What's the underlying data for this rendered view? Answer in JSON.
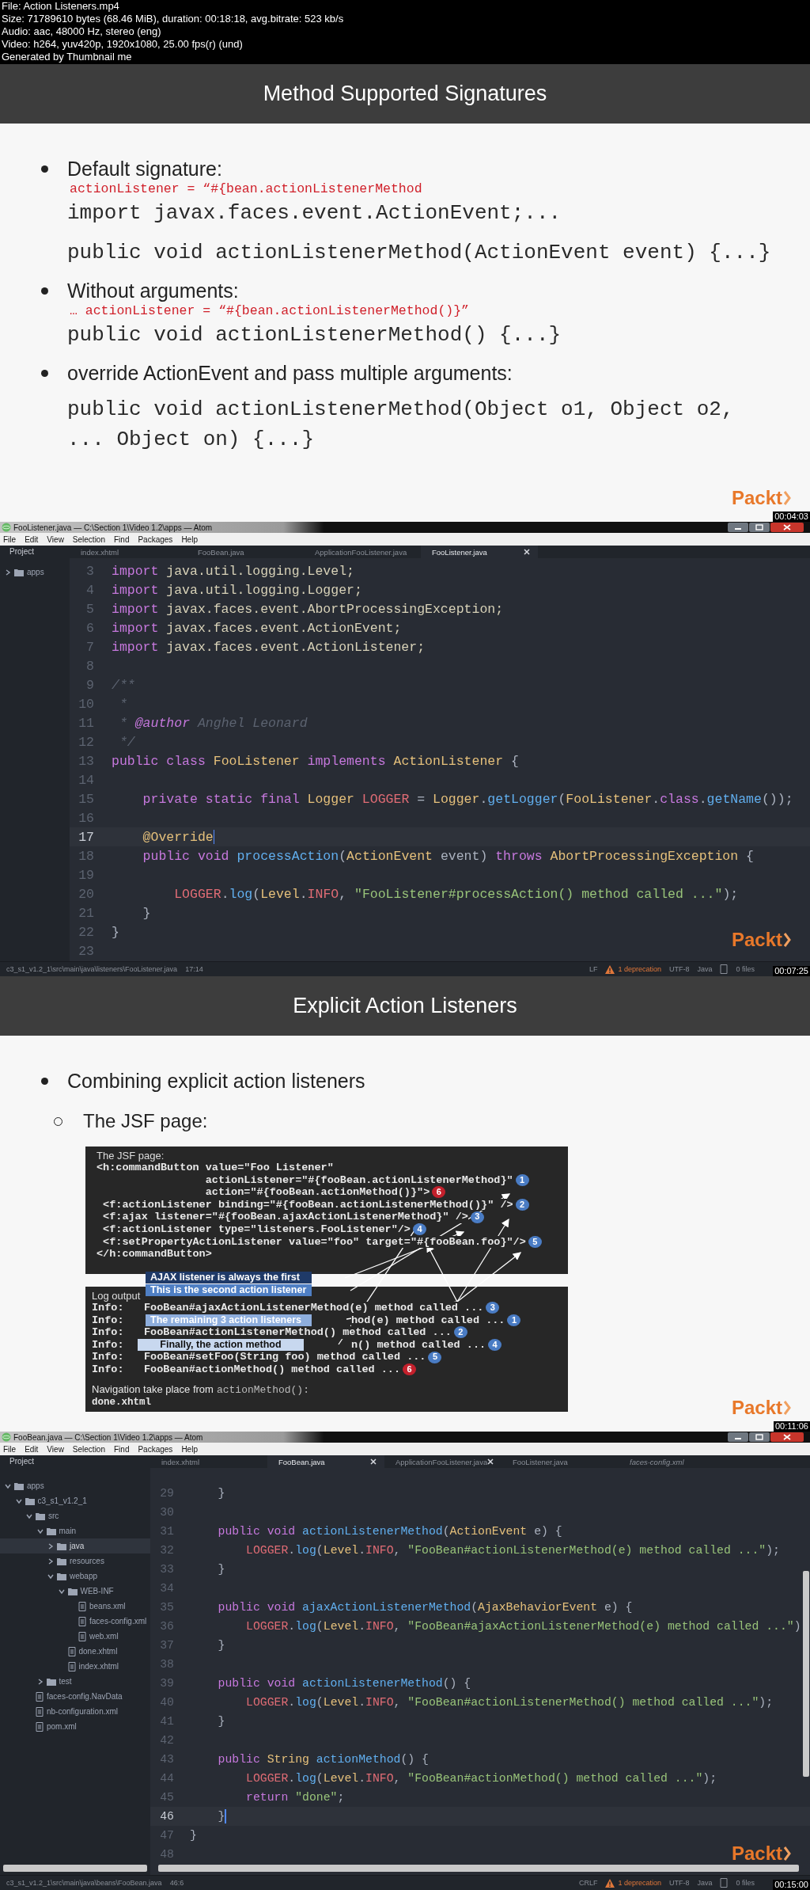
{
  "info_header": {
    "lines": [
      "File: Action Listeners.mp4",
      "Size: 71789610 bytes (68.46 MiB), duration: 00:18:18, avg.bitrate: 523 kb/s",
      "Audio: aac, 48000 Hz, stereo (eng)",
      "Video: h264, yuv420p, 1920x1080, 25.00 fps(r) (und)",
      "Generated by Thumbnail me"
    ]
  },
  "frames": [
    {
      "kind": "slide",
      "title": "Method Supported Signatures",
      "logo": "Packt",
      "timestamp": "00:04:03",
      "bullets": [
        {
          "text": "Default signature:",
          "details": [
            {
              "kind": "attribute",
              "text": "actionListener = “#{bean.actionListenerMethod"
            },
            {
              "kind": "code",
              "text": "import javax.faces.event.ActionEvent;..."
            },
            {
              "kind": "code",
              "text": "public void actionListenerMethod(ActionEvent event) {...}"
            }
          ]
        },
        {
          "text": "Without arguments:",
          "details": [
            {
              "kind": "attribute",
              "text": "… actionListener = “#{bean.actionListenerMethod()}”"
            },
            {
              "kind": "code",
              "text": "public void actionListenerMethod() {...}"
            }
          ]
        },
        {
          "text": "override ActionEvent and pass multiple arguments:",
          "details": [
            {
              "kind": "code",
              "text": "public void actionListenerMethod(Object o1, Object o2, ... Object on) {...}"
            }
          ]
        }
      ]
    },
    {
      "kind": "editor",
      "window_title": "FooListener.java — C:\\Section 1\\Video 1.2\\apps — Atom",
      "menu": [
        "File",
        "Edit",
        "View",
        "Selection",
        "Find",
        "Packages",
        "Help"
      ],
      "logo": "Packt",
      "timestamp": "00:07:25",
      "sidebar": {
        "header": "Project",
        "tree": [
          {
            "name": "apps",
            "kind": "folder",
            "expanded": false,
            "selected": false
          }
        ]
      },
      "tabs": [
        {
          "label": "index.xhtml",
          "selected": false,
          "closable": false,
          "preview": false
        },
        {
          "label": "FooBean.java",
          "selected": false,
          "closable": false,
          "preview": false
        },
        {
          "label": "ApplicationFooListener.java",
          "selected": false,
          "closable": false,
          "preview": false
        },
        {
          "label": "FooListener.java",
          "selected": true,
          "closable": true,
          "preview": false
        }
      ],
      "lines": [
        {
          "number": "3",
          "current": false,
          "tokens": [
            {
              "kind": "kw",
              "text": "import "
            },
            {
              "kind": "pkg",
              "text": "java.util.logging.Level;"
            }
          ]
        },
        {
          "number": "4",
          "current": false,
          "tokens": [
            {
              "kind": "kw",
              "text": "import "
            },
            {
              "kind": "pkg",
              "text": "java.util.logging.Logger;"
            }
          ]
        },
        {
          "number": "5",
          "current": false,
          "tokens": [
            {
              "kind": "kw",
              "text": "import "
            },
            {
              "kind": "pkg",
              "text": "javax.faces.event.AbortProcessingException;"
            }
          ]
        },
        {
          "number": "6",
          "current": false,
          "tokens": [
            {
              "kind": "kw",
              "text": "import "
            },
            {
              "kind": "pkg",
              "text": "javax.faces.event.ActionEvent;"
            }
          ]
        },
        {
          "number": "7",
          "current": false,
          "tokens": [
            {
              "kind": "kw",
              "text": "import "
            },
            {
              "kind": "pkg",
              "text": "javax.faces.event.ActionListener;"
            }
          ]
        },
        {
          "number": "8",
          "current": false
        },
        {
          "number": "9",
          "current": false,
          "tokens": [
            {
              "kind": "comment",
              "text": "/**"
            }
          ]
        },
        {
          "number": "10",
          "current": false,
          "tokens": [
            {
              "kind": "comment",
              "text": " *"
            }
          ]
        },
        {
          "number": "11",
          "current": false,
          "tokens": [
            {
              "kind": "comment",
              "text": " * "
            },
            {
              "kind": "doctag",
              "text": "@author"
            },
            {
              "kind": "comment",
              "text": " Anghel Leonard"
            }
          ]
        },
        {
          "number": "12",
          "current": false,
          "tokens": [
            {
              "kind": "comment",
              "text": " */"
            }
          ]
        },
        {
          "number": "13",
          "current": false,
          "tokens": [
            {
              "kind": "kw",
              "text": "public class "
            },
            {
              "kind": "type",
              "text": "FooListener"
            },
            {
              "kind": "kw",
              "text": " implements "
            },
            {
              "kind": "type",
              "text": "ActionListener"
            },
            {
              "kind": "plain",
              "text": " {"
            }
          ]
        },
        {
          "number": "14",
          "current": false
        },
        {
          "number": "15",
          "current": false,
          "tokens": [
            {
              "kind": "kw",
              "text": "    private static final "
            },
            {
              "kind": "type",
              "text": "Logger"
            },
            {
              "kind": "const",
              "text": " LOGGER"
            },
            {
              "kind": "plain",
              "text": " = "
            },
            {
              "kind": "type",
              "text": "Logger"
            },
            {
              "kind": "plain",
              "text": "."
            },
            {
              "kind": "fn",
              "text": "getLogger"
            },
            {
              "kind": "plain",
              "text": "("
            },
            {
              "kind": "type",
              "text": "FooListener"
            },
            {
              "kind": "plain",
              "text": "."
            },
            {
              "kind": "kw",
              "text": "class"
            },
            {
              "kind": "plain",
              "text": "."
            },
            {
              "kind": "fn",
              "text": "getName"
            },
            {
              "kind": "plain",
              "text": "());"
            }
          ]
        },
        {
          "number": "16",
          "current": false
        },
        {
          "number": "17",
          "current": true,
          "tokens": [
            {
              "kind": "type",
              "text": "    @Override"
            }
          ]
        },
        {
          "number": "18",
          "current": false,
          "tokens": [
            {
              "kind": "kw",
              "text": "    public void "
            },
            {
              "kind": "fn",
              "text": "processAction"
            },
            {
              "kind": "plain",
              "text": "("
            },
            {
              "kind": "type",
              "text": "ActionEvent"
            },
            {
              "kind": "plain",
              "text": " event) "
            },
            {
              "kind": "kw",
              "text": "throws "
            },
            {
              "kind": "type",
              "text": "AbortProcessingException"
            },
            {
              "kind": "plain",
              "text": " {"
            }
          ]
        },
        {
          "number": "19",
          "current": false
        },
        {
          "number": "20",
          "current": false,
          "tokens": [
            {
              "kind": "const",
              "text": "        LOGGER"
            },
            {
              "kind": "plain",
              "text": "."
            },
            {
              "kind": "fn",
              "text": "log"
            },
            {
              "kind": "plain",
              "text": "("
            },
            {
              "kind": "type",
              "text": "Level"
            },
            {
              "kind": "plain",
              "text": "."
            },
            {
              "kind": "const",
              "text": "INFO"
            },
            {
              "kind": "plain",
              "text": ", "
            },
            {
              "kind": "str",
              "text": "\"FooListener#processAction() method called ...\""
            },
            {
              "kind": "plain",
              "text": ");"
            }
          ]
        },
        {
          "number": "21",
          "current": false,
          "tokens": [
            {
              "kind": "plain",
              "text": "    }"
            }
          ]
        },
        {
          "number": "22",
          "current": false,
          "tokens": [
            {
              "kind": "plain",
              "text": "}"
            }
          ]
        },
        {
          "number": "23",
          "current": false
        }
      ],
      "status": {
        "path": "c3_s1_v1.2_1\\src\\main\\java\\listeners\\FooListener.java",
        "cursor": "17:14",
        "line_ending": "LF",
        "warning": "1 deprecation",
        "encoding": "UTF-8",
        "grammar": "Java",
        "files": "0 files"
      }
    },
    {
      "kind": "slide",
      "title": "Explicit Action Listeners",
      "logo": "Packt",
      "timestamp": "00:11:06",
      "bullets": [
        {
          "text": "Combining explicit action listeners",
          "children": [
            {
              "text": "The JSF page:"
            }
          ]
        }
      ],
      "diagram": {
        "page_title": "The JSF page:",
        "code_lines": [
          {
            "kind": "open",
            "text": "<h:commandButton value=\"Foo Listener\""
          },
          {
            "kind": "attr",
            "text": "actionListener=\"#{fooBean.actionListenerMethod}\"",
            "badge": {
              "number": "1",
              "color": "#4a7cc4"
            }
          },
          {
            "kind": "attr",
            "text": "action=\"#{fooBean.actionMethod()}\">",
            "badge": {
              "number": "6",
              "color": "#c4202c"
            }
          },
          {
            "kind": "child",
            "text": "<f:actionListener binding=\"#{fooBean.actionListenerMethod()}\" />",
            "badge": {
              "number": "2",
              "color": "#4a7cc4"
            }
          },
          {
            "kind": "child",
            "text": "<f:ajax listener=\"#{fooBean.ajaxActionListenerMethod}\" />",
            "badge": {
              "number": "3",
              "color": "#4a7cc4"
            }
          },
          {
            "kind": "child",
            "text": "<f:actionListener type=\"listeners.FooListener\"/>",
            "badge": {
              "number": "4",
              "color": "#4a7cc4"
            }
          },
          {
            "kind": "child",
            "text": "<f:setPropertyActionListener value=\"foo\" target=\"#{fooBean.foo}\"/>",
            "badge": {
              "number": "5",
              "color": "#4a7cc4"
            }
          },
          {
            "kind": "close",
            "text": "</h:commandButton>"
          }
        ],
        "log_title": "Log output",
        "log_rows": [
          {
            "label": "Info:",
            "text": "FooBean#ajaxActionListenerMethod(e) method called ...",
            "covered": false,
            "badge": {
              "number": "3",
              "color": "#4a7cc4"
            }
          },
          {
            "label": "Info:",
            "text": "hod(e) method called ...",
            "covered": true,
            "badge": {
              "number": "1",
              "color": "#4a7cc4"
            }
          },
          {
            "label": "Info:",
            "text": "FooBean#actionListenerMethod() method called ...",
            "covered": false,
            "badge": {
              "number": "2",
              "color": "#4a7cc4"
            }
          },
          {
            "label": "Info:",
            "text": "n() method called ...",
            "covered": true,
            "badge": {
              "number": "4",
              "color": "#4a7cc4"
            }
          },
          {
            "label": "Info:",
            "text": "FooBean#setFoo(String foo) method called ...",
            "covered": false,
            "badge": {
              "number": "5",
              "color": "#4a7cc4"
            }
          },
          {
            "label": "Info:",
            "text": "FooBean#actionMethod() method called ...",
            "covered": false,
            "badge": {
              "number": "6",
              "color": "#c4202c"
            }
          }
        ],
        "nav_text": "Navigation take place from",
        "nav_code": "actionMethod():",
        "result": "done.xhtml",
        "callouts": [
          {
            "text": "AJAX listener is always the first",
            "color": "#1f3a68"
          },
          {
            "text": "This is the second action listener",
            "color": "#4f7fc4"
          },
          {
            "text": "The remaining 3 action listeners",
            "color": "#8eaedd"
          },
          {
            "text": "Finally, the action method",
            "color": "#c8d8ef"
          }
        ]
      }
    },
    {
      "kind": "editor",
      "window_title": "FooBean.java — C:\\Section 1\\Video 1.2\\apps — Atom",
      "menu": [
        "File",
        "Edit",
        "View",
        "Selection",
        "Find",
        "Packages",
        "Help"
      ],
      "logo": "Packt",
      "timestamp": "00:15:00",
      "sidebar": {
        "header": "Project",
        "tree": [
          {
            "name": "apps",
            "kind": "folder",
            "expanded": true,
            "selected": false,
            "children": [
              {
                "name": "c3_s1_v1.2_1",
                "kind": "folder",
                "expanded": true,
                "selected": false,
                "children": [
                  {
                    "name": "src",
                    "kind": "folder",
                    "expanded": true,
                    "selected": false,
                    "children": [
                      {
                        "name": "main",
                        "kind": "folder",
                        "expanded": true,
                        "selected": false,
                        "children": [
                          {
                            "name": "java",
                            "kind": "folder",
                            "expanded": false,
                            "selected": true
                          },
                          {
                            "name": "resources",
                            "kind": "folder",
                            "expanded": false,
                            "selected": false
                          },
                          {
                            "name": "webapp",
                            "kind": "folder",
                            "expanded": true,
                            "selected": false,
                            "children": [
                              {
                                "name": "WEB-INF",
                                "kind": "folder",
                                "expanded": true,
                                "selected": false,
                                "children": [
                                  {
                                    "name": "beans.xml",
                                    "kind": "file",
                                    "selected": false
                                  },
                                  {
                                    "name": "faces-config.xml",
                                    "kind": "file",
                                    "selected": false
                                  },
                                  {
                                    "name": "web.xml",
                                    "kind": "file",
                                    "selected": false
                                  }
                                ]
                              },
                              {
                                "name": "done.xhtml",
                                "kind": "file",
                                "selected": false
                              },
                              {
                                "name": "index.xhtml",
                                "kind": "file",
                                "selected": false
                              }
                            ]
                          }
                        ]
                      },
                      {
                        "name": "test",
                        "kind": "folder",
                        "expanded": false,
                        "selected": false
                      }
                    ]
                  },
                  {
                    "name": "faces-config.NavData",
                    "kind": "file",
                    "selected": false
                  },
                  {
                    "name": "nb-configuration.xml",
                    "kind": "file",
                    "selected": false
                  },
                  {
                    "name": "pom.xml",
                    "kind": "file",
                    "selected": false
                  }
                ]
              }
            ]
          }
        ]
      },
      "tabs": [
        {
          "label": "index.xhtml",
          "selected": false,
          "closable": false,
          "preview": false
        },
        {
          "label": "FooBean.java",
          "selected": true,
          "closable": true,
          "preview": false
        },
        {
          "label": "ApplicationFooListener.java",
          "selected": false,
          "closable": true,
          "preview": false
        },
        {
          "label": "FooListener.java",
          "selected": false,
          "closable": false,
          "preview": false
        },
        {
          "label": "faces-config.xml",
          "selected": false,
          "closable": false,
          "preview": true
        }
      ],
      "lines": [
        {
          "number": "29",
          "current": false,
          "tokens": [
            {
              "kind": "plain",
              "text": "    }"
            }
          ]
        },
        {
          "number": "30",
          "current": false
        },
        {
          "number": "31",
          "current": false,
          "tokens": [
            {
              "kind": "kw",
              "text": "    public void "
            },
            {
              "kind": "fn",
              "text": "actionListenerMethod"
            },
            {
              "kind": "plain",
              "text": "("
            },
            {
              "kind": "type",
              "text": "ActionEvent"
            },
            {
              "kind": "plain",
              "text": " e) {"
            }
          ]
        },
        {
          "number": "32",
          "current": false,
          "tokens": [
            {
              "kind": "const",
              "text": "        LOGGER"
            },
            {
              "kind": "plain",
              "text": "."
            },
            {
              "kind": "fn",
              "text": "log"
            },
            {
              "kind": "plain",
              "text": "("
            },
            {
              "kind": "type",
              "text": "Level"
            },
            {
              "kind": "plain",
              "text": "."
            },
            {
              "kind": "const",
              "text": "INFO"
            },
            {
              "kind": "plain",
              "text": ", "
            },
            {
              "kind": "str",
              "text": "\"FooBean#actionListenerMethod(e) method called ...\""
            },
            {
              "kind": "plain",
              "text": ");"
            }
          ]
        },
        {
          "number": "33",
          "current": false,
          "tokens": [
            {
              "kind": "plain",
              "text": "    }"
            }
          ]
        },
        {
          "number": "34",
          "current": false
        },
        {
          "number": "35",
          "current": false,
          "tokens": [
            {
              "kind": "kw",
              "text": "    public void "
            },
            {
              "kind": "fn",
              "text": "ajaxActionListenerMethod"
            },
            {
              "kind": "plain",
              "text": "("
            },
            {
              "kind": "type",
              "text": "AjaxBehaviorEvent"
            },
            {
              "kind": "plain",
              "text": " e) {"
            }
          ]
        },
        {
          "number": "36",
          "current": false,
          "tokens": [
            {
              "kind": "const",
              "text": "        LOGGER"
            },
            {
              "kind": "plain",
              "text": "."
            },
            {
              "kind": "fn",
              "text": "log"
            },
            {
              "kind": "plain",
              "text": "("
            },
            {
              "kind": "type",
              "text": "Level"
            },
            {
              "kind": "plain",
              "text": "."
            },
            {
              "kind": "const",
              "text": "INFO"
            },
            {
              "kind": "plain",
              "text": ", "
            },
            {
              "kind": "str",
              "text": "\"FooBean#ajaxActionListenerMethod(e) method called ...\""
            },
            {
              "kind": "plain",
              "text": ")"
            }
          ]
        },
        {
          "number": "37",
          "current": false,
          "tokens": [
            {
              "kind": "plain",
              "text": "    }"
            }
          ]
        },
        {
          "number": "38",
          "current": false
        },
        {
          "number": "39",
          "current": false,
          "tokens": [
            {
              "kind": "kw",
              "text": "    public void "
            },
            {
              "kind": "fn",
              "text": "actionListenerMethod"
            },
            {
              "kind": "plain",
              "text": "() {"
            }
          ]
        },
        {
          "number": "40",
          "current": false,
          "tokens": [
            {
              "kind": "const",
              "text": "        LOGGER"
            },
            {
              "kind": "plain",
              "text": "."
            },
            {
              "kind": "fn",
              "text": "log"
            },
            {
              "kind": "plain",
              "text": "("
            },
            {
              "kind": "type",
              "text": "Level"
            },
            {
              "kind": "plain",
              "text": "."
            },
            {
              "kind": "const",
              "text": "INFO"
            },
            {
              "kind": "plain",
              "text": ", "
            },
            {
              "kind": "str",
              "text": "\"FooBean#actionListenerMethod() method called ...\""
            },
            {
              "kind": "plain",
              "text": ");"
            }
          ]
        },
        {
          "number": "41",
          "current": false,
          "tokens": [
            {
              "kind": "plain",
              "text": "    }"
            }
          ]
        },
        {
          "number": "42",
          "current": false
        },
        {
          "number": "43",
          "current": false,
          "tokens": [
            {
              "kind": "kw",
              "text": "    public "
            },
            {
              "kind": "type",
              "text": "String"
            },
            {
              "kind": "fn",
              "text": " actionMethod"
            },
            {
              "kind": "plain",
              "text": "() {"
            }
          ]
        },
        {
          "number": "44",
          "current": false,
          "tokens": [
            {
              "kind": "const",
              "text": "        LOGGER"
            },
            {
              "kind": "plain",
              "text": "."
            },
            {
              "kind": "fn",
              "text": "log"
            },
            {
              "kind": "plain",
              "text": "("
            },
            {
              "kind": "type",
              "text": "Level"
            },
            {
              "kind": "plain",
              "text": "."
            },
            {
              "kind": "const",
              "text": "INFO"
            },
            {
              "kind": "plain",
              "text": ", "
            },
            {
              "kind": "str",
              "text": "\"FooBean#actionMethod() method called ...\""
            },
            {
              "kind": "plain",
              "text": ");"
            }
          ]
        },
        {
          "number": "45",
          "current": false,
          "tokens": [
            {
              "kind": "kw",
              "text": "        return "
            },
            {
              "kind": "str",
              "text": "\"done\""
            },
            {
              "kind": "plain",
              "text": ";"
            }
          ]
        },
        {
          "number": "46",
          "current": true,
          "tokens": [
            {
              "kind": "plain",
              "text": "    }"
            }
          ]
        },
        {
          "number": "47",
          "current": false,
          "tokens": [
            {
              "kind": "plain",
              "text": "}"
            }
          ]
        },
        {
          "number": "48",
          "current": false
        }
      ],
      "status": {
        "path": "c3_s1_v1.2_1\\src\\main\\java\\beans\\FooBean.java",
        "cursor": "46:6",
        "line_ending": "CRLF",
        "warning": "1 deprecation",
        "encoding": "UTF-8",
        "grammar": "Java",
        "files": "0 files"
      }
    }
  ]
}
